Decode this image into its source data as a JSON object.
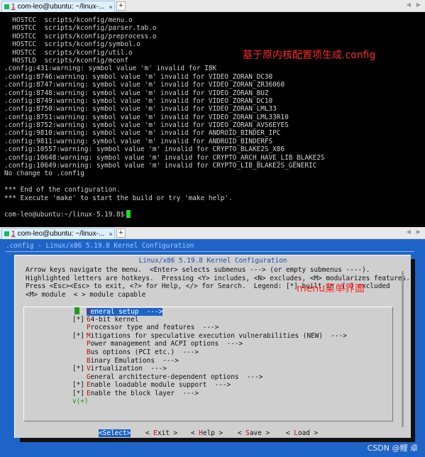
{
  "tab1": {
    "num": "1",
    "title": "com-leo@ubuntu: ~/linux-...",
    "close": "×"
  },
  "tab2": {
    "num": "1",
    "title": "com-leo@ubuntu: ~/linux-...",
    "close": "×"
  },
  "new_tab": "+",
  "terminal_lines": [
    "  HOSTCC  scripts/kconfig/menu.o",
    "  HOSTCC  scripts/kconfig/parser.tab.o",
    "  HOSTCC  scripts/kconfig/preprocess.o",
    "  HOSTCC  scripts/kconfig/symbol.o",
    "  HOSTCC  scripts/kconfig/util.o",
    "  HOSTLD  scripts/kconfig/mconf",
    ".config:431:warning: symbol value 'm' invalid for I8K",
    ".config:8746:warning: symbol value 'm' invalid for VIDEO_ZORAN_DC30",
    ".config:8747:warning: symbol value 'm' invalid for VIDEO_ZORAN_ZR36060",
    ".config:8748:warning: symbol value 'm' invalid for VIDEO_ZORAN_BUZ",
    ".config:8749:warning: symbol value 'm' invalid for VIDEO_ZORAN_DC10",
    ".config:8750:warning: symbol value 'm' invalid for VIDEO_ZORAN_LML33",
    ".config:8751:warning: symbol value 'm' invalid for VIDEO_ZORAN_LML33R10",
    ".config:8752:warning: symbol value 'm' invalid for VIDEO_ZORAN_AVS6EYES",
    ".config:9810:warning: symbol value 'm' invalid for ANDROID_BINDER_IPC",
    ".config:9811:warning: symbol value 'm' invalid for ANDROID_BINDERFS",
    ".config:10557:warning: symbol value 'm' invalid for CRYPTO_BLAKE2S_X86",
    ".config:10648:warning: symbol value 'm' invalid for CRYPTO_ARCH_HAVE_LIB_BLAKE2S",
    ".config:10649:warning: symbol value 'm' invalid for CRYPTO_LIB_BLAKE2S_GENERIC",
    "No change to .config",
    "",
    "*** End of the configuration.",
    "*** Execute 'make' to start the build or try 'make help'.",
    "",
    "com-leo@ubuntu:~/linux-5.19.8$"
  ],
  "annotation1": "基于原内核配置项生成.config",
  "menuconfig": {
    "headline": ".config - Linux/x86 5.19.8 Kernel Configuration",
    "dialog_title": "Linux/x86 5.19.8 Kernel Configuration",
    "help_lines": [
      "Arrow keys navigate the menu.  <Enter> selects submenus ---> (or empty submenus ----).",
      "Highlighted letters are hotkeys.  Pressing <Y> includes, <N> excludes, <M> modularizes features.",
      "Press <Esc><Esc> to exit, <?> for Help, </> for Search.  Legend: [*] built-in  [ ] excluded",
      "<M> module  < > module capable"
    ],
    "items": [
      {
        "prefix": "",
        "hotkey": "G",
        "rest": "eneral setup  --->",
        "selected": true
      },
      {
        "prefix": "[*]",
        "hotkey": "6",
        "rest": "4-bit kernel",
        "selected": false
      },
      {
        "prefix": "",
        "hotkey": "P",
        "rest": "rocessor type and features  --->",
        "selected": false
      },
      {
        "prefix": "[*]",
        "hotkey": "M",
        "rest": "itigations for speculative execution vulnerabilities (NEW)  --->",
        "selected": false
      },
      {
        "prefix": "",
        "hotkey": "P",
        "rest": "ower management and ACPI options  --->",
        "selected": false
      },
      {
        "prefix": "",
        "hotkey": "B",
        "rest": "us options (PCI etc.)  --->",
        "selected": false
      },
      {
        "prefix": "",
        "hotkey": "B",
        "rest": "inary Emulations  --->",
        "selected": false
      },
      {
        "prefix": "[*]",
        "hotkey": "V",
        "rest": "irtualization  --->",
        "selected": false
      },
      {
        "prefix": "",
        "hotkey": "G",
        "rest": "eneral architecture-dependent options  --->",
        "selected": false
      },
      {
        "prefix": "[*]",
        "hotkey": "E",
        "rest": "nable loadable module support  --->",
        "selected": false
      },
      {
        "prefix": "[*]",
        "hotkey": "E",
        "rest": "nable the block layer  --->",
        "selected": false
      }
    ],
    "more_indicator": "v(+)",
    "annotation2": "menu菜单界面",
    "buttons": [
      {
        "pre": "<",
        "hotkey": "S",
        "post": "elect>",
        "active": true
      },
      {
        "pre": "< ",
        "hotkey": "E",
        "post": "xit >",
        "active": false
      },
      {
        "pre": "< ",
        "hotkey": "H",
        "post": "elp >",
        "active": false
      },
      {
        "pre": "< ",
        "hotkey": "S",
        "post": "ave >",
        "active": false
      },
      {
        "pre": "< ",
        "hotkey": "L",
        "post": "oad >",
        "active": false
      }
    ]
  },
  "watermark": "CSDN @鲤 卓",
  "colors": {
    "terminal_bg": "#000000",
    "menu_bg": "#1e64c8",
    "dialog_bg": "#cfcfcf",
    "annotation": "#ff2a2a",
    "cursor": "#22dd22"
  }
}
